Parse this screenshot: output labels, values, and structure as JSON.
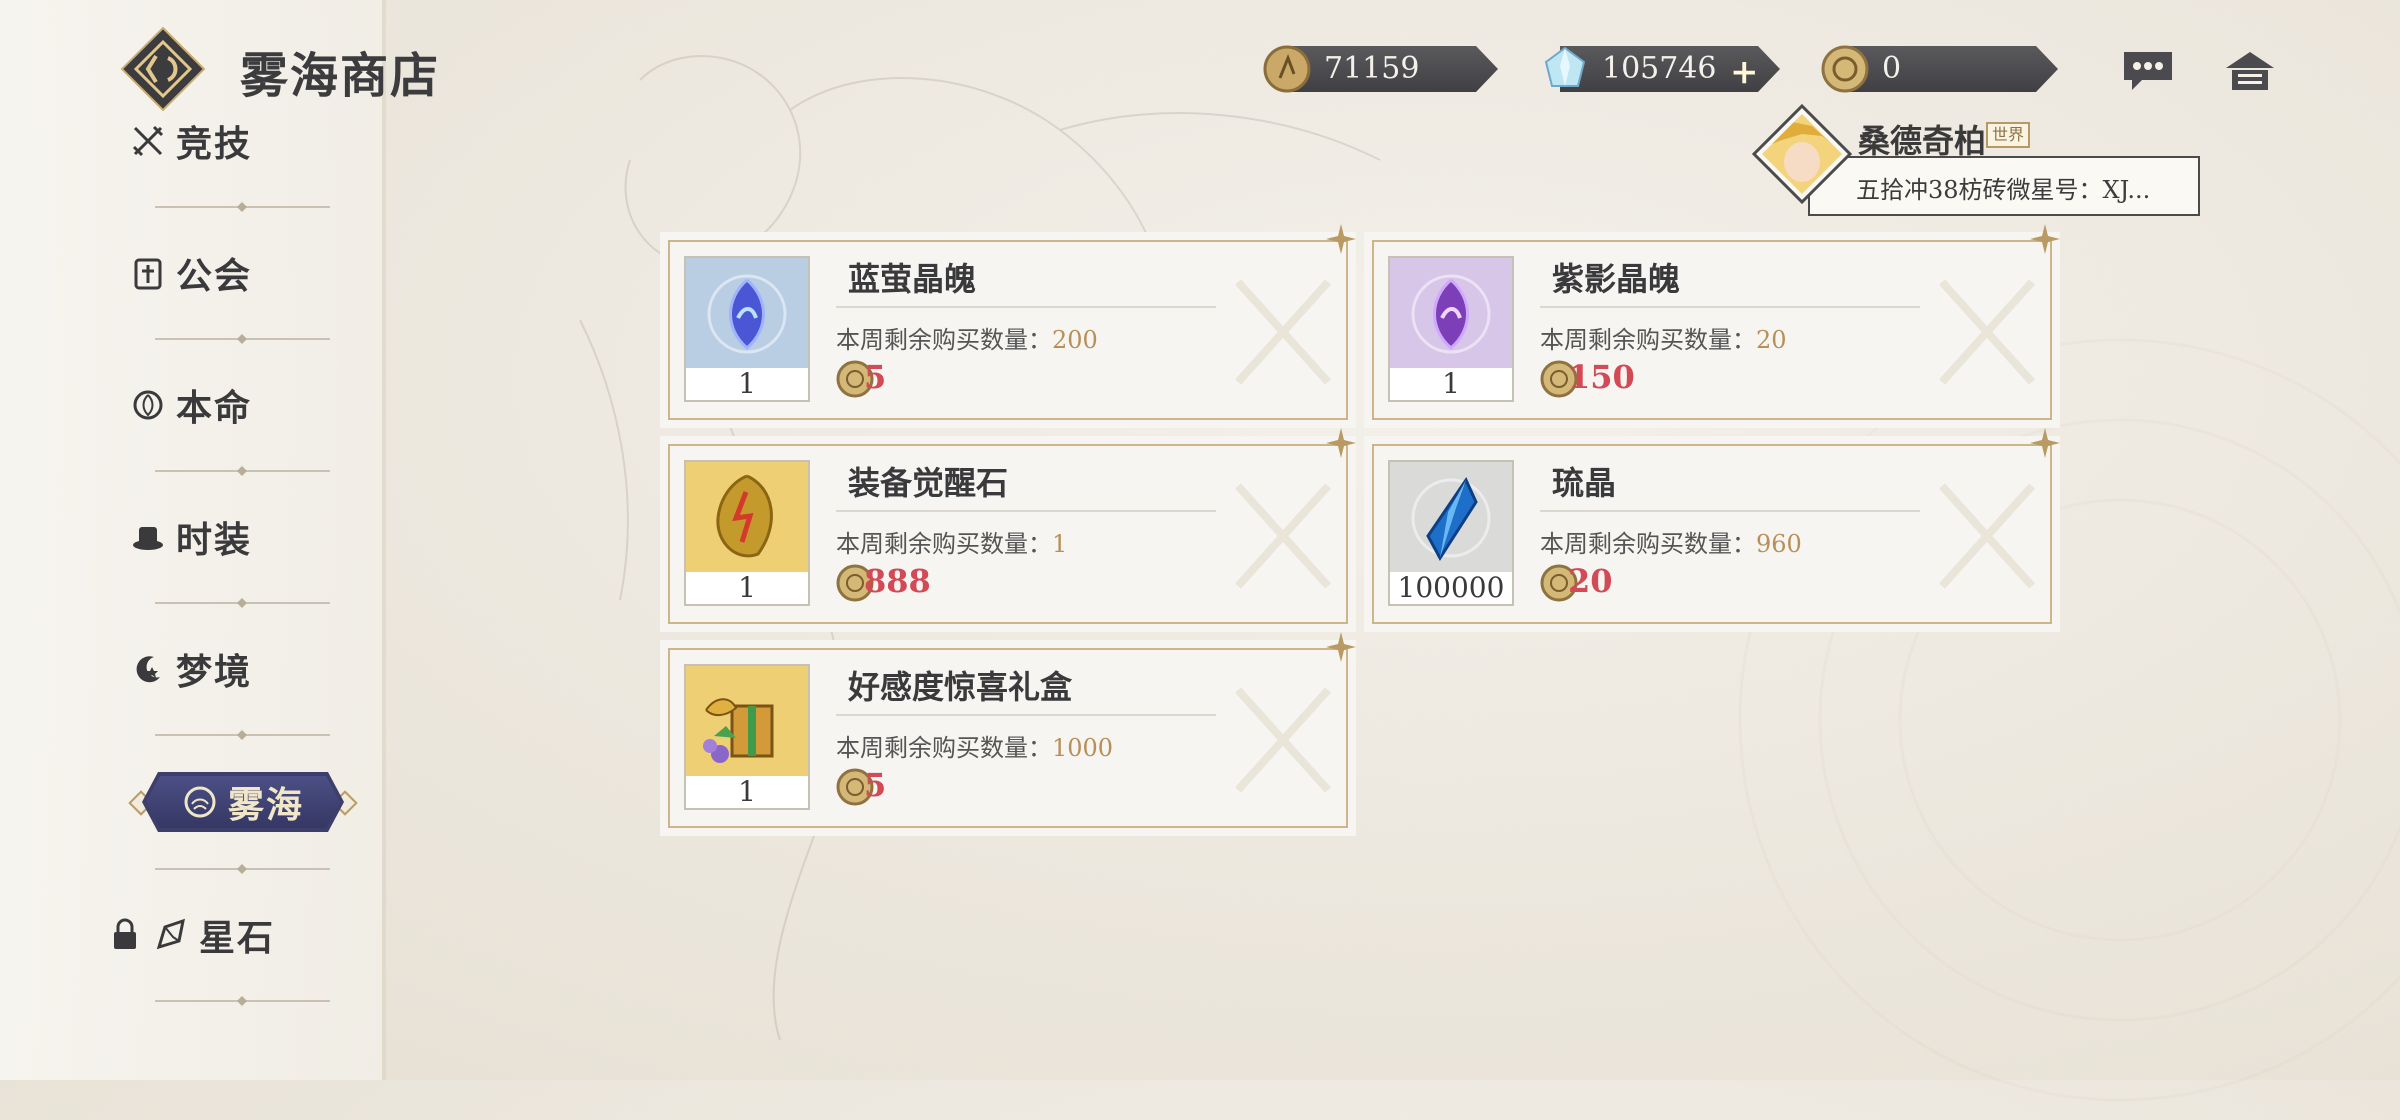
{
  "header": {
    "title": "雾海商店"
  },
  "sidebar": {
    "items": [
      {
        "label": "竞技",
        "icon": "swords-icon"
      },
      {
        "label": "公会",
        "icon": "guild-shield-icon"
      },
      {
        "label": "本命",
        "icon": "lotus-icon"
      },
      {
        "label": "时装",
        "icon": "hat-icon"
      },
      {
        "label": "梦境",
        "icon": "crescent-star-icon"
      },
      {
        "label": "雾海",
        "icon": "mist-sea-icon",
        "active": true
      },
      {
        "label": "星石",
        "icon": "star-stone-icon",
        "locked": true
      }
    ]
  },
  "currencies": [
    {
      "value": "71159",
      "icon": "gold-coin-icon"
    },
    {
      "value": "105746",
      "icon": "crystal-gem-icon",
      "plus": "+"
    },
    {
      "value": "0",
      "icon": "mist-token-icon"
    }
  ],
  "profile": {
    "name": "桑德奇柏",
    "badge": "世界",
    "message": "五拾冲38枋砖微星号：XJ..."
  },
  "items": [
    {
      "name": "蓝萤晶魄",
      "remain_label": "本周剩余购买数量：",
      "remain": "200",
      "quantity": "1",
      "price": "5",
      "icon": "blue-soul-crystal-icon",
      "bg": "#b9cde3"
    },
    {
      "name": "紫影晶魄",
      "remain_label": "本周剩余购买数量：",
      "remain": "20",
      "quantity": "1",
      "price": "150",
      "icon": "purple-soul-crystal-icon",
      "bg": "#d7c6e8"
    },
    {
      "name": "装备觉醒石",
      "remain_label": "本周剩余购买数量：",
      "remain": "1",
      "quantity": "1",
      "price": "888",
      "icon": "awakening-stone-icon",
      "bg": "#efcf74"
    },
    {
      "name": "琉晶",
      "remain_label": "本周剩余购买数量：",
      "remain": "960",
      "quantity": "100000",
      "price": "20",
      "icon": "blue-crystal-icon",
      "bg": "#dadad9"
    },
    {
      "name": "好感度惊喜礼盒",
      "remain_label": "本周剩余购买数量：",
      "remain": "1000",
      "quantity": "1",
      "price": "5",
      "icon": "gift-box-icon",
      "bg": "#efcf74"
    }
  ],
  "colors": {
    "accent_gold": "#b99c64",
    "price_red": "#d24a55",
    "active_nav": "#3d3f6a"
  }
}
